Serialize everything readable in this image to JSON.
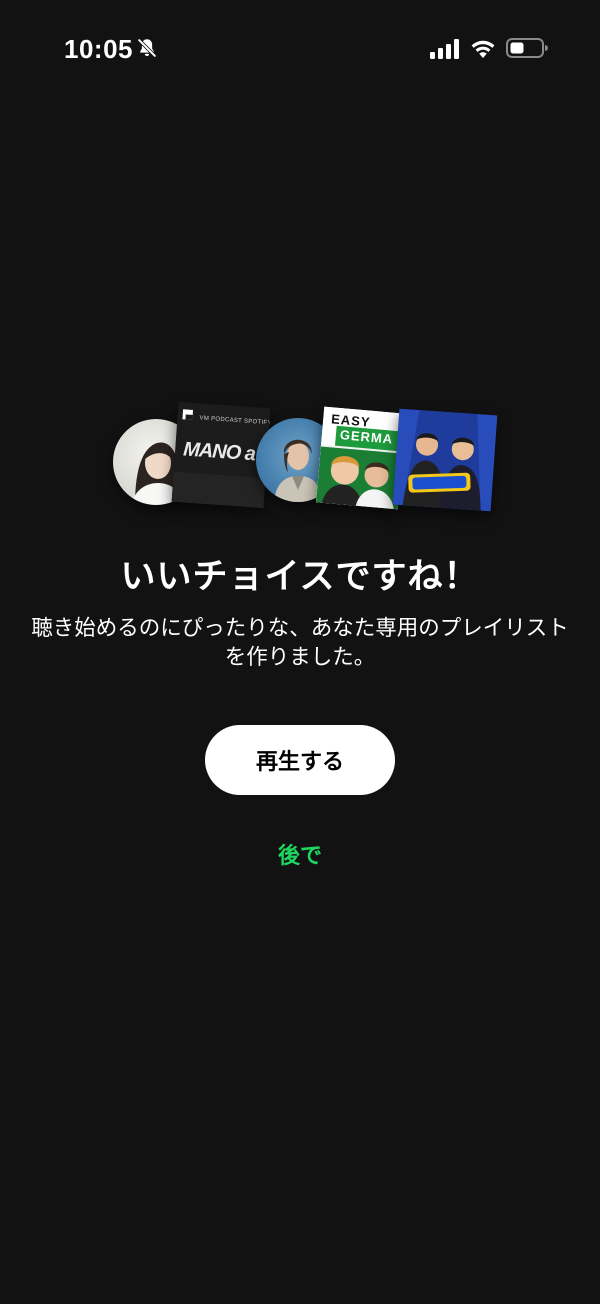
{
  "status_bar": {
    "time": "10:05",
    "icons": [
      "bell-off-icon",
      "signal-icon",
      "wifi-icon",
      "battery-icon"
    ]
  },
  "artwork": {
    "items": [
      {
        "name": "podcast-cover-portrait-woman",
        "shape": "circle"
      },
      {
        "name": "podcast-cover-mano-a-mano",
        "label": "VM PODCAST SPOTIFY",
        "title": "MANO a MA"
      },
      {
        "name": "podcast-cover-portrait-man",
        "shape": "circle"
      },
      {
        "name": "podcast-cover-easy-german",
        "title_line1": "EASY",
        "title_line2": "GERMA"
      },
      {
        "name": "podcast-cover-radio-show"
      }
    ]
  },
  "headline": "いいチョイスですね！",
  "subtitle": "聴き始めるのにぴったりな、あなた専用のプレイリストを作りました。",
  "buttons": {
    "play_label": "再生する",
    "later_label": "後で"
  },
  "colors": {
    "background": "#121212",
    "accent_green": "#1ed760",
    "primary_button": "#ffffff"
  }
}
